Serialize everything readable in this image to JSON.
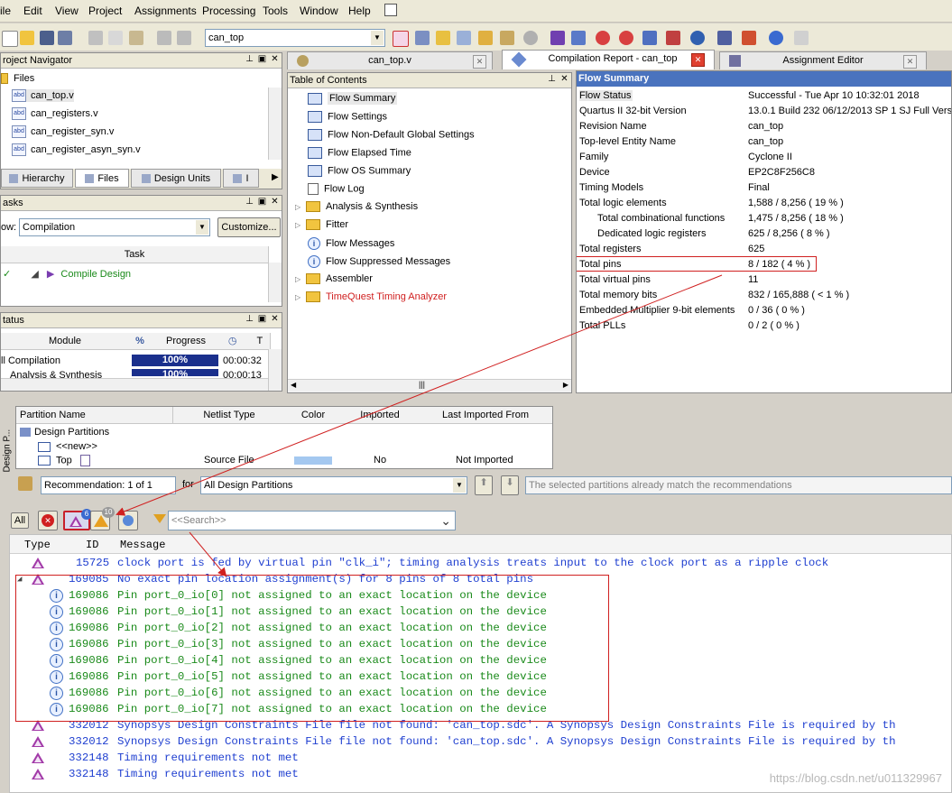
{
  "menu": [
    "ile",
    "Edit",
    "View",
    "Project",
    "Assignments",
    "Processing",
    "Tools",
    "Window",
    "Help"
  ],
  "toolbar": {
    "entity": "can_top"
  },
  "project_navigator": {
    "title": "roject Navigator",
    "files_header": "Files",
    "files": [
      "can_top.v",
      "can_registers.v",
      "can_register_syn.v",
      "can_register_asyn_syn.v"
    ],
    "tabs": [
      "Hierarchy",
      "Files",
      "Design Units",
      "I"
    ]
  },
  "tasks": {
    "title": "asks",
    "flow_label": "ow:",
    "flow_value": "Compilation",
    "customize": "Customize...",
    "column_task": "Task",
    "rows": [
      "Compile Design"
    ]
  },
  "status": {
    "title": "tatus",
    "columns": [
      "Module",
      "%",
      "Progress",
      "T"
    ],
    "rows": [
      {
        "module": "ll Compilation",
        "progress": "100%",
        "time": "00:00:32"
      },
      {
        "module": "Analysis & Synthesis",
        "progress": "100%",
        "time": "00:00:13"
      }
    ]
  },
  "tabs": {
    "file_tab": "can_top.v",
    "report_tab": "Compilation Report - can_top",
    "assign_tab": "Assignment Editor"
  },
  "toc": {
    "title": "Table of Contents",
    "items": [
      {
        "label": "Flow Summary",
        "kind": "table",
        "selected": true
      },
      {
        "label": "Flow Settings",
        "kind": "table"
      },
      {
        "label": "Flow Non-Default Global Settings",
        "kind": "table"
      },
      {
        "label": "Flow Elapsed Time",
        "kind": "table"
      },
      {
        "label": "Flow OS Summary",
        "kind": "table"
      },
      {
        "label": "Flow Log",
        "kind": "doc"
      },
      {
        "label": "Analysis & Synthesis",
        "kind": "folder"
      },
      {
        "label": "Fitter",
        "kind": "folder"
      },
      {
        "label": "Flow Messages",
        "kind": "info"
      },
      {
        "label": "Flow Suppressed Messages",
        "kind": "info"
      },
      {
        "label": "Assembler",
        "kind": "folder"
      },
      {
        "label": "TimeQuest Timing Analyzer",
        "kind": "folder",
        "red": true
      }
    ]
  },
  "flow_summary": {
    "title": "Flow Summary",
    "rows": [
      {
        "k": "Flow Status",
        "v": "Successful - Tue Apr 10 10:32:01 2018"
      },
      {
        "k": "Quartus II 32-bit Version",
        "v": "13.0.1 Build 232 06/12/2013 SP 1 SJ Full Versio"
      },
      {
        "k": "Revision Name",
        "v": "can_top"
      },
      {
        "k": "Top-level Entity Name",
        "v": "can_top"
      },
      {
        "k": "Family",
        "v": "Cyclone II"
      },
      {
        "k": "Device",
        "v": "EP2C8F256C8"
      },
      {
        "k": "Timing Models",
        "v": "Final"
      },
      {
        "k": "Total logic elements",
        "v": "1,588 / 8,256 ( 19 % )"
      },
      {
        "k": "Total combinational functions",
        "v": "1,475 / 8,256 ( 18 % )",
        "indent": true
      },
      {
        "k": "Dedicated logic registers",
        "v": "625 / 8,256 ( 8 % )",
        "indent": true
      },
      {
        "k": "Total registers",
        "v": "625"
      },
      {
        "k": "Total pins",
        "v": "8 / 182 ( 4 % )"
      },
      {
        "k": "Total virtual pins",
        "v": "11"
      },
      {
        "k": "Total memory bits",
        "v": "832 / 165,888 ( < 1 % )"
      },
      {
        "k": "Embedded Multiplier 9-bit elements",
        "v": "0 / 36 ( 0 % )"
      },
      {
        "k": "Total PLLs",
        "v": "0 / 2 ( 0 % )"
      }
    ]
  },
  "partitions": {
    "side_label": "Design P...",
    "columns": [
      "Partition Name",
      "Netlist Type",
      "Color",
      "Imported",
      "Last Imported From"
    ],
    "rows": [
      {
        "name": "Design Partitions",
        "netlist": "",
        "imported": "",
        "from": ""
      },
      {
        "name": "<<new>>",
        "netlist": "",
        "imported": "",
        "from": ""
      },
      {
        "name": "Top",
        "netlist": "Source File",
        "imported": "No",
        "from": "Not Imported"
      }
    ],
    "recommendation": "Recommendation: 1 of 1",
    "for_label": "for",
    "for_value": "All Design Partitions",
    "note": "The selected partitions already match the recommendations"
  },
  "messages_bar": {
    "all": "All",
    "warn_count": "6",
    "crit_count": "10",
    "search_placeholder": "<<Search>>"
  },
  "messages": {
    "columns": [
      "Type",
      "ID",
      "Message"
    ],
    "rows": [
      {
        "type": "warn",
        "id": "15725",
        "text": "clock port is fed by virtual pin \"clk_i\"; timing analysis treats input to the clock port as a ripple clock",
        "color": "#1f3fd0"
      },
      {
        "type": "warn",
        "id": "169085",
        "text": "No exact pin location assignment(s) for 8 pins of 8 total pins",
        "color": "#1f3fd0",
        "expand": true
      },
      {
        "type": "info",
        "id": "169086",
        "text": "Pin port_0_io[0] not assigned to an exact location on the device",
        "color": "#1a8a1a"
      },
      {
        "type": "info",
        "id": "169086",
        "text": "Pin port_0_io[1] not assigned to an exact location on the device",
        "color": "#1a8a1a"
      },
      {
        "type": "info",
        "id": "169086",
        "text": "Pin port_0_io[2] not assigned to an exact location on the device",
        "color": "#1a8a1a"
      },
      {
        "type": "info",
        "id": "169086",
        "text": "Pin port_0_io[3] not assigned to an exact location on the device",
        "color": "#1a8a1a"
      },
      {
        "type": "info",
        "id": "169086",
        "text": "Pin port_0_io[4] not assigned to an exact location on the device",
        "color": "#1a8a1a"
      },
      {
        "type": "info",
        "id": "169086",
        "text": "Pin port_0_io[5] not assigned to an exact location on the device",
        "color": "#1a8a1a"
      },
      {
        "type": "info",
        "id": "169086",
        "text": "Pin port_0_io[6] not assigned to an exact location on the device",
        "color": "#1a8a1a"
      },
      {
        "type": "info",
        "id": "169086",
        "text": "Pin port_0_io[7] not assigned to an exact location on the device",
        "color": "#1a8a1a"
      },
      {
        "type": "warn",
        "id": "332012",
        "text": "Synopsys Design Constraints File file not found: 'can_top.sdc'. A Synopsys Design Constraints File is required by th",
        "color": "#1f3fd0"
      },
      {
        "type": "warn",
        "id": "332012",
        "text": "Synopsys Design Constraints File file not found: 'can_top.sdc'. A Synopsys Design Constraints File is required by th",
        "color": "#1f3fd0"
      },
      {
        "type": "warn",
        "id": "332148",
        "text": "Timing requirements not met",
        "color": "#1f3fd0"
      },
      {
        "type": "warn",
        "id": "332148",
        "text": "Timing requirements not met",
        "color": "#1f3fd0"
      }
    ]
  },
  "watermark": "https://blog.csdn.net/u011329967"
}
